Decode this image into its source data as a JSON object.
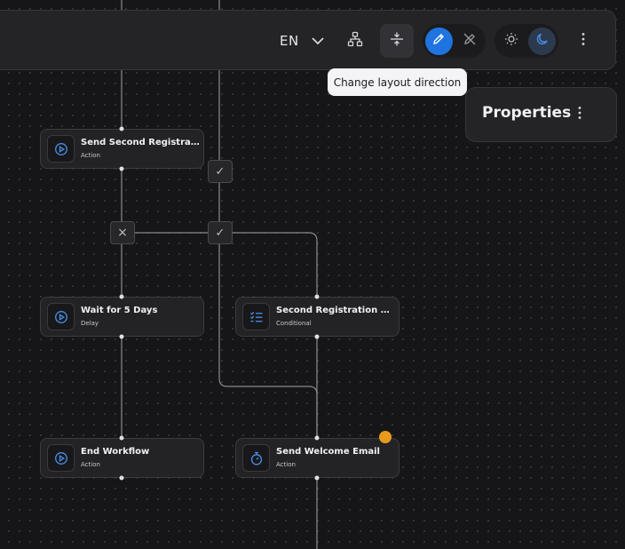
{
  "toolbar": {
    "language": "EN",
    "tooltip": "Change layout direction",
    "icons": {
      "language_dropdown": "chevron-down-icon",
      "tree_view": "sitemap-icon",
      "layout_direction": "vertical-split-icon",
      "edit_mode": "pencil-icon",
      "view_mode": "pencil-off-icon",
      "light_theme": "sun-icon",
      "dark_theme": "moon-icon",
      "more": "more-vertical-icon"
    },
    "edit_mode_active": true,
    "theme": "dark"
  },
  "properties": {
    "title": "Properties",
    "more_icon": "more-vertical-icon"
  },
  "nodes": [
    {
      "title": "Send Second Registration",
      "subtitle": "Action",
      "icon": "play-circle-icon"
    },
    {
      "title": "Wait for 5 Days",
      "subtitle": "Delay",
      "icon": "play-circle-icon"
    },
    {
      "title": "Second Registration Check",
      "subtitle": "Conditional",
      "icon": "checklist-icon"
    },
    {
      "title": "End Workflow",
      "subtitle": "Action",
      "icon": "play-circle-icon"
    },
    {
      "title": "Send Welcome Email",
      "subtitle": "Action",
      "icon": "timer-icon",
      "status_dot": true
    }
  ],
  "branch_badges": [
    {
      "symbol": "✓",
      "icon": "check-icon"
    },
    {
      "symbol": "×",
      "icon": "x-icon"
    },
    {
      "symbol": "✓",
      "icon": "check-icon"
    }
  ],
  "colors": {
    "canvas": "#161618",
    "panel": "#242427",
    "accent_blue": "#1f74e0",
    "status_orange": "#e89a1c",
    "icon_blue": "#4a8fe8"
  }
}
